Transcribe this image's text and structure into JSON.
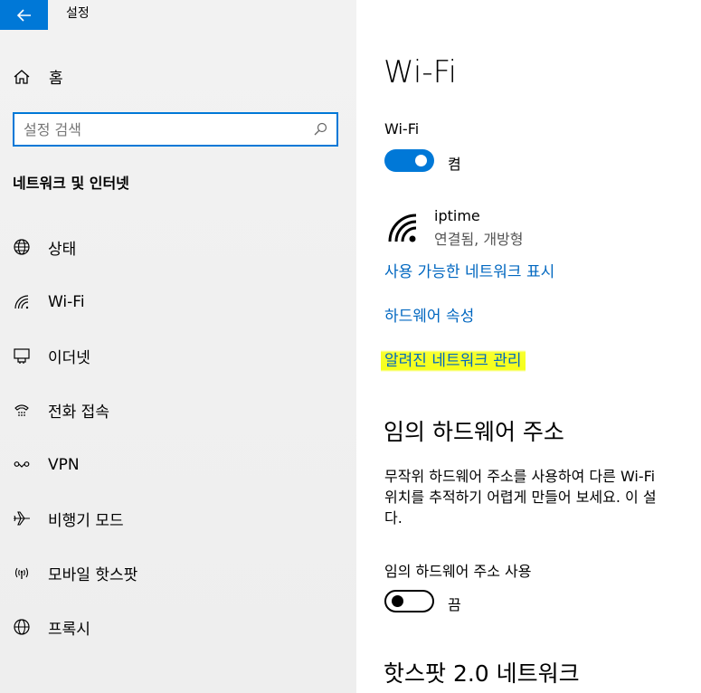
{
  "window": {
    "title": "설정"
  },
  "sidebar": {
    "home_label": "홈",
    "search": {
      "placeholder": "설정 검색",
      "value": ""
    },
    "section_title": "네트워크 및 인터넷",
    "items": [
      {
        "label": "상태",
        "icon": "globe-status-icon"
      },
      {
        "label": "Wi-Fi",
        "icon": "wifi-icon"
      },
      {
        "label": "이더넷",
        "icon": "ethernet-icon"
      },
      {
        "label": "전화 접속",
        "icon": "dialup-icon"
      },
      {
        "label": "VPN",
        "icon": "vpn-icon"
      },
      {
        "label": "비행기 모드",
        "icon": "airplane-icon"
      },
      {
        "label": "모바일 핫스팟",
        "icon": "hotspot-icon"
      },
      {
        "label": "프록시",
        "icon": "proxy-globe-icon"
      }
    ]
  },
  "main": {
    "title": "Wi-Fi",
    "wifi_label": "Wi-Fi",
    "wifi_toggle_state": "켬",
    "network": {
      "name": "iptime",
      "status": "연결됨, 개방형"
    },
    "links": {
      "show_available": "사용 가능한 네트워크 표시",
      "hardware_props": "하드웨어 속성",
      "manage_known": "알려진 네트워크 관리"
    },
    "random_hw": {
      "heading": "임의 하드웨어 주소",
      "description_lines": [
        "무작위 하드웨어 주소를 사용하여 다른 Wi-Fi",
        "위치를 추적하기 어렵게 만들어 보세요. 이 설",
        "다."
      ],
      "toggle_label": "임의 하드웨어 주소 사용",
      "toggle_state": "끔"
    },
    "hotspot_heading": "핫스팟 2.0 네트워크"
  },
  "colors": {
    "accent": "#0078d7",
    "link": "#0067c0",
    "highlight": "#f5ff1a"
  }
}
